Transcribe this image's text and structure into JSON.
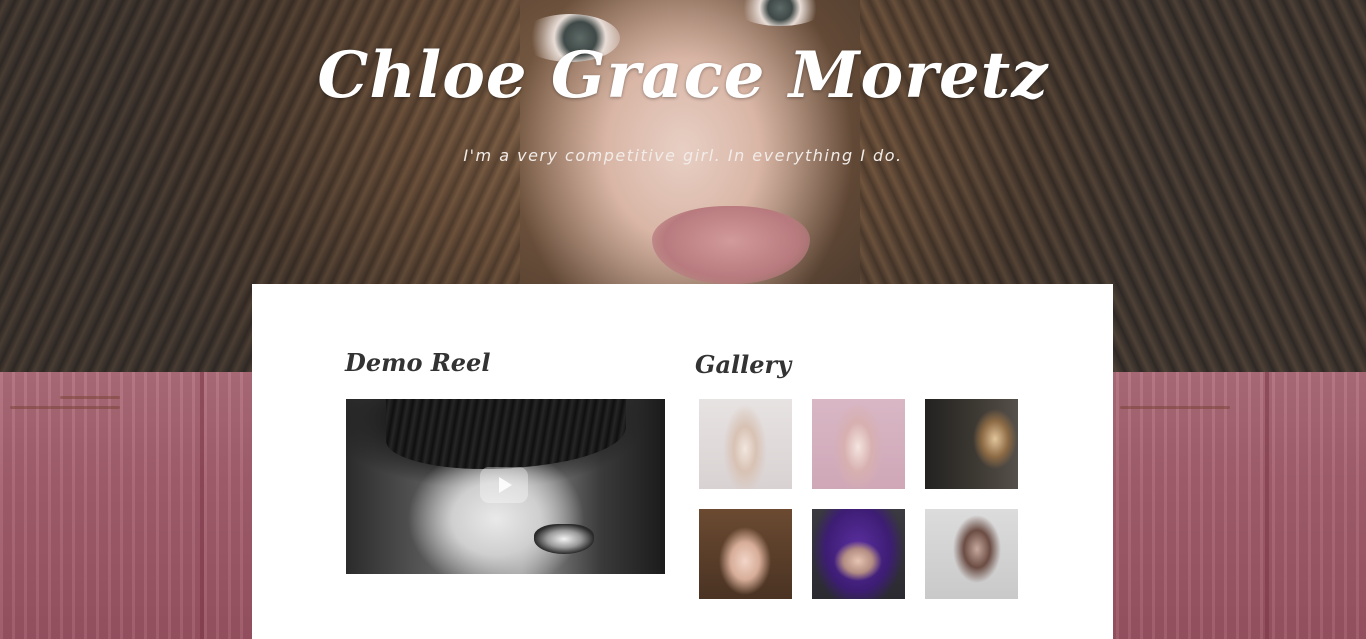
{
  "header": {
    "title": "Chloe Grace Moretz",
    "tagline": "I'm a very competitive girl. In everything I do."
  },
  "demo_reel": {
    "heading": "Demo Reel",
    "icon": "play-icon"
  },
  "gallery": {
    "heading": "Gallery",
    "item_count": 6
  },
  "colors": {
    "card_background": "#ffffff",
    "heading_text": "#333333",
    "title_text": "#ffffff",
    "lower_background": "#a6606f"
  }
}
